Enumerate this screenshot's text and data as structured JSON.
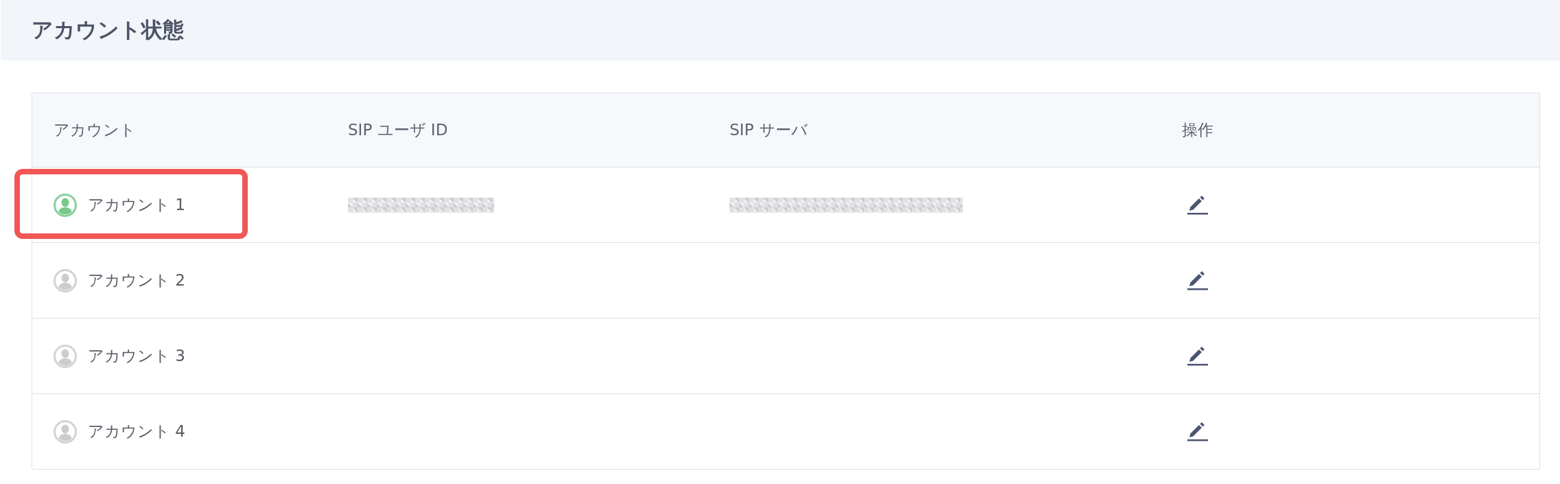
{
  "page": {
    "title": "アカウント状態"
  },
  "table": {
    "columns": [
      "アカウント",
      "SIP ユーザ ID",
      "SIP サーバ",
      "操作"
    ],
    "rows": [
      {
        "account": "アカウント 1",
        "active": true,
        "highlighted": true,
        "sip_user_id": {
          "kind": "redacted"
        },
        "sip_server": {
          "kind": "redacted"
        }
      },
      {
        "account": "アカウント 2",
        "active": false,
        "highlighted": false
      },
      {
        "account": "アカウント 3",
        "active": false,
        "highlighted": false
      },
      {
        "account": "アカウント 4",
        "active": false,
        "highlighted": false
      }
    ]
  }
}
